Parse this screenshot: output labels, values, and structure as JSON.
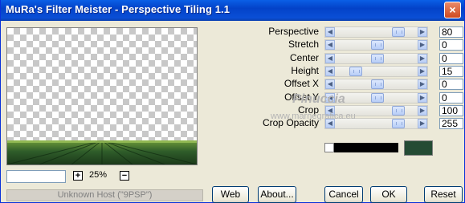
{
  "window": {
    "title": "MuRa's Filter Meister - Perspective Tiling 1.1",
    "close_glyph": "×"
  },
  "zoom": {
    "plus": "+",
    "minus": "−",
    "value": "25%",
    "input_value": ""
  },
  "host_status": "Unknown Host (\"9PSP\")",
  "sliders": [
    {
      "label": "Perspective",
      "value": "80",
      "level": 0.8
    },
    {
      "label": "Stretch",
      "value": "0",
      "level": 0.5
    },
    {
      "label": "Center",
      "value": "0",
      "level": 0.5
    },
    {
      "label": "Height",
      "value": "15",
      "level": 0.2
    },
    {
      "label": "Offset X",
      "value": "0",
      "level": 0.5
    },
    {
      "label": "Offset Y",
      "value": "0",
      "level": 0.5
    },
    {
      "label": "Crop",
      "value": "100",
      "level": 0.8
    },
    {
      "label": "Crop Opacity",
      "value": "255",
      "level": 0.8
    }
  ],
  "arrows": {
    "left": "◀",
    "right": "▶"
  },
  "watermark": {
    "name": "Pinuccia",
    "url": "www.marnegrafica.eu"
  },
  "colors": {
    "swatch": "#244b34",
    "preview_ground": "#2f5d2a"
  },
  "buttons": {
    "web": "Web",
    "about": "About...",
    "cancel": "Cancel",
    "ok": "OK",
    "reset": "Reset"
  }
}
